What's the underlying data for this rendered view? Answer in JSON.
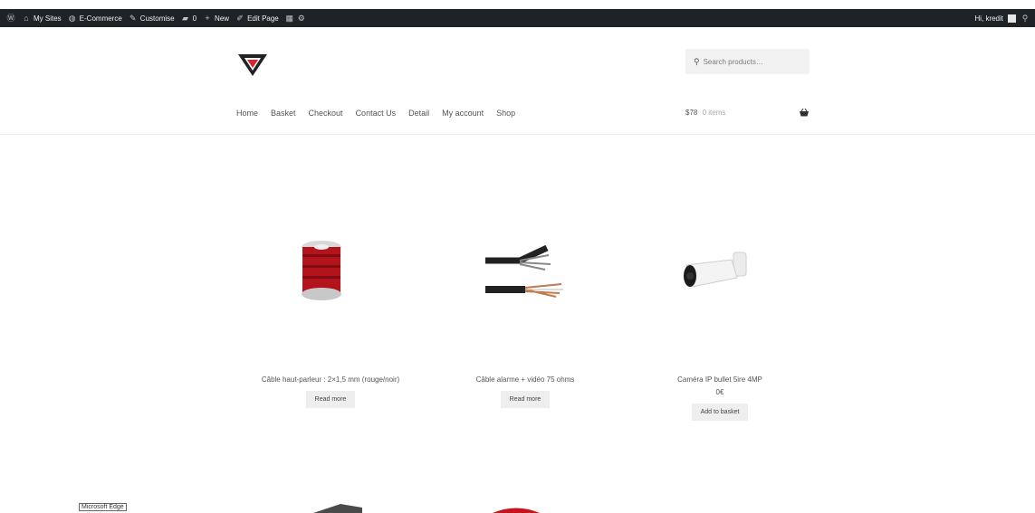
{
  "admin_bar": {
    "items": [
      {
        "icon": "wordpress-icon",
        "label": ""
      },
      {
        "icon": "sites-icon",
        "label": "My Sites"
      },
      {
        "icon": "ecommerce-icon",
        "label": "E-Commerce"
      },
      {
        "icon": "brush-icon",
        "label": "Customise"
      },
      {
        "icon": "comment-icon",
        "label": "0"
      },
      {
        "icon": "plus-icon",
        "label": "New"
      },
      {
        "icon": "pencil-icon",
        "label": "Edit Page"
      },
      {
        "icon": "grid-icon",
        "label": ""
      }
    ],
    "greeting": "Hi, kredit"
  },
  "header": {
    "search_placeholder": "Search products…",
    "nav": [
      "Home",
      "Basket",
      "Checkout",
      "Contact Us",
      "Detail",
      "My account",
      "Shop"
    ],
    "cart_total": "$78",
    "cart_items": "0 items"
  },
  "products": [
    {
      "title": "Câble haut-parleur : 2×1,5 mm (rouge/noir)",
      "button": "Read more"
    },
    {
      "title": "Câble alarme + vidéo 75 ohms",
      "button": "Read more"
    },
    {
      "title": "Caméra IP bullet 5ire 4MP",
      "price": "0€",
      "button": "Add to basket"
    }
  ],
  "taskbar_tooltip": "Microsoft Edge"
}
